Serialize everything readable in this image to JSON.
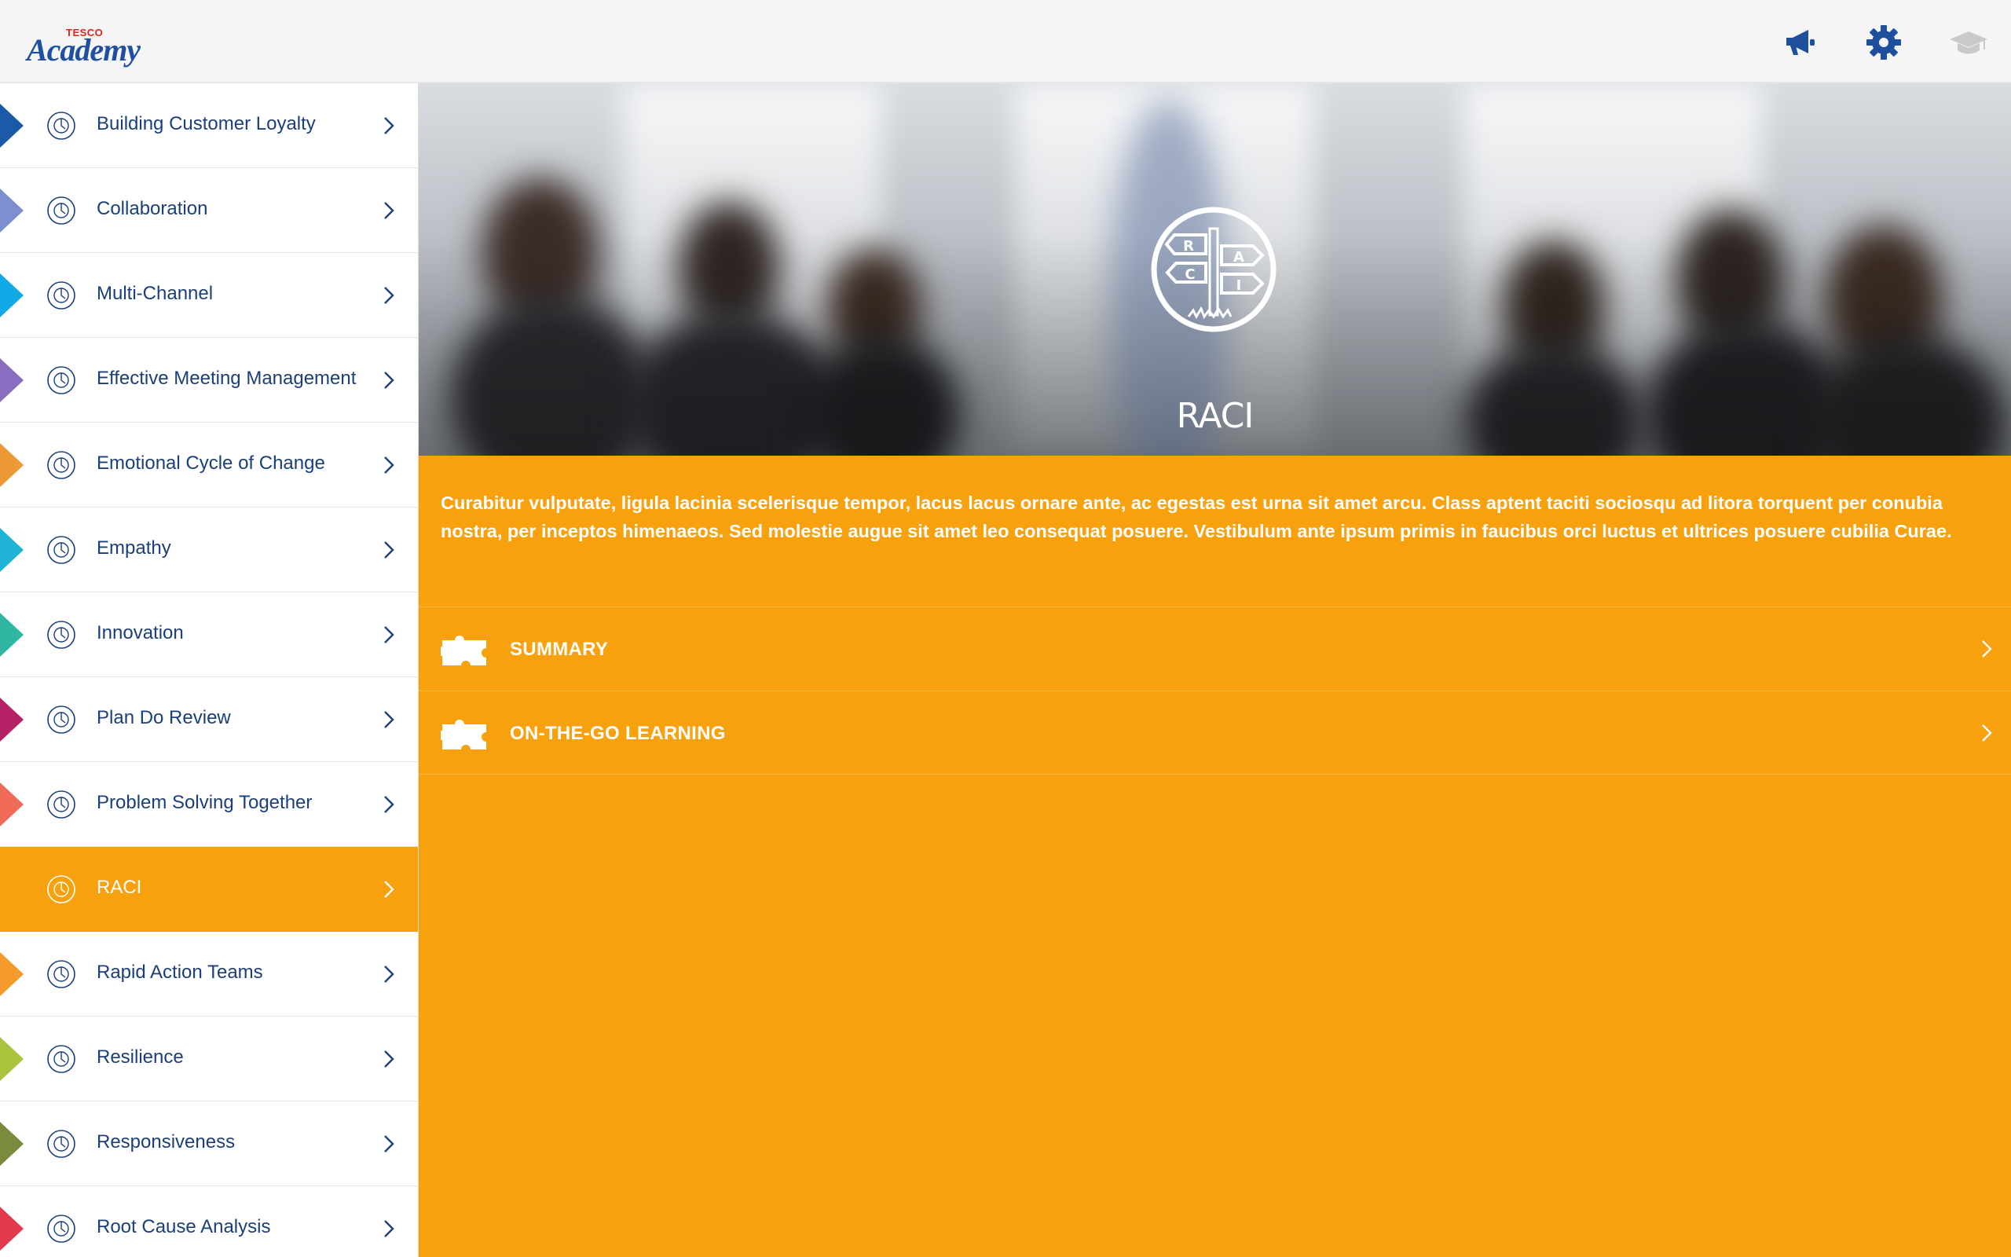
{
  "header": {
    "logo_brand": "TESCO",
    "logo_wordmark": "Academy",
    "icons": [
      "megaphone-icon",
      "gear-icon",
      "graduation-cap-icon"
    ]
  },
  "sidebar": {
    "items": [
      {
        "label": "Building Customer Loyalty",
        "color": "#1a5aa6",
        "icon": "stopwatch-icon"
      },
      {
        "label": "Collaboration",
        "color": "#7e8fd0",
        "icon": "globe-people-icon"
      },
      {
        "label": "Multi-Channel",
        "color": "#12a9e6",
        "icon": "tablet-icon"
      },
      {
        "label": "Effective Meeting Management",
        "color": "#8a6cc0",
        "icon": "people-group-icon"
      },
      {
        "label": "Emotional Cycle of Change",
        "color": "#ec9a35",
        "icon": "globe-icon"
      },
      {
        "label": "Empathy",
        "color": "#21b3d6",
        "icon": "heart-icon"
      },
      {
        "label": "Innovation",
        "color": "#2fb7a3",
        "icon": "lightbulb-icon"
      },
      {
        "label": "Plan Do Review",
        "color": "#b52267",
        "icon": "calendar-icon"
      },
      {
        "label": "Problem Solving Together",
        "color": "#ef6b56",
        "icon": "team-icon"
      },
      {
        "label": "RACI",
        "color": "#f8a10f",
        "icon": "signpost-icon",
        "active": true
      },
      {
        "label": "Rapid Action Teams",
        "color": "#f39a2a",
        "icon": "shoe-icon"
      },
      {
        "label": "Resilience",
        "color": "#a8c43c",
        "icon": "head-gears-icon"
      },
      {
        "label": "Responsiveness",
        "color": "#7b8b3e",
        "icon": "timer-icon"
      },
      {
        "label": "Root Cause Analysis",
        "color": "#e23a4e",
        "icon": "magnifier-icon"
      }
    ]
  },
  "hero": {
    "title": "RACI",
    "emblem_letters": [
      "R",
      "A",
      "C",
      "I"
    ],
    "emblem_icon": "signpost-icon"
  },
  "content": {
    "description": "Curabitur vulputate, ligula lacinia scelerisque tempor, lacus lacus ornare ante, ac egestas est urna sit amet arcu. Class aptent taciti sociosqu ad litora torquent per conubia nostra, per inceptos himenaeos. Sed molestie augue sit amet leo consequat posuere. Vestibulum ante ipsum primis in faucibus orci luctus et ultrices posuere cubilia Curae.",
    "rows": [
      {
        "label": "SUMMARY",
        "icon": "puzzle-icon"
      },
      {
        "label": "ON-THE-GO LEARNING",
        "icon": "puzzle-icon"
      }
    ]
  },
  "colors": {
    "accent": "#f8a10f",
    "navy": "#1a3f7a",
    "topbar": "#f5f5f5"
  }
}
